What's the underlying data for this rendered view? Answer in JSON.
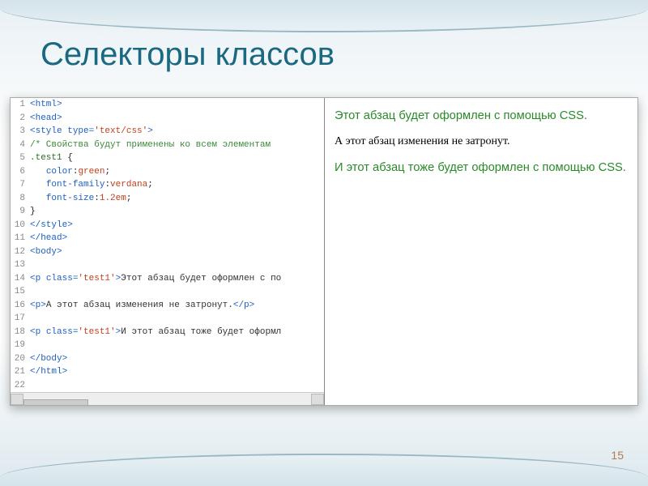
{
  "title": "Селекторы классов",
  "code": {
    "lines": [
      {
        "n": "1",
        "html": "<span class='tag'>&lt;html&gt;</span>"
      },
      {
        "n": "2",
        "html": "<span class='tag'>&lt;head&gt;</span>"
      },
      {
        "n": "3",
        "html": "<span class='tag'>&lt;style</span> <span class='attr'>type=</span><span class='val'>'text/css'</span><span class='tag'>&gt;</span>"
      },
      {
        "n": "4",
        "html": "<span class='comment'>/* Свойства будут применены ко всем элементам </span>"
      },
      {
        "n": "5",
        "html": "<span class='sel'>.test1</span> {"
      },
      {
        "n": "6",
        "html": "   <span class='prop'>color</span>:<span class='pval'>green</span>;"
      },
      {
        "n": "7",
        "html": "   <span class='prop'>font-family</span>:<span class='pval'>verdana</span>;"
      },
      {
        "n": "8",
        "html": "   <span class='prop'>font-size</span>:<span class='pval'>1.2em</span>;"
      },
      {
        "n": "9",
        "html": "}"
      },
      {
        "n": "10",
        "html": "<span class='tag'>&lt;/style&gt;</span>"
      },
      {
        "n": "11",
        "html": "<span class='tag'>&lt;/head&gt;</span>"
      },
      {
        "n": "12",
        "html": "<span class='tag'>&lt;body&gt;</span>"
      },
      {
        "n": "13",
        "html": ""
      },
      {
        "n": "14",
        "html": "<span class='tag'>&lt;p</span> <span class='attr'>class=</span><span class='val'>'test1'</span><span class='tag'>&gt;</span><span class='txt'>Этот абзац будет оформлен с по</span>"
      },
      {
        "n": "15",
        "html": ""
      },
      {
        "n": "16",
        "html": "<span class='tag'>&lt;p&gt;</span><span class='txt'>А этот абзац изменения не затронут.</span><span class='tag'>&lt;/p&gt;</span>"
      },
      {
        "n": "17",
        "html": ""
      },
      {
        "n": "18",
        "html": "<span class='tag'>&lt;p</span> <span class='attr'>class=</span><span class='val'>'test1'</span><span class='tag'>&gt;</span><span class='txt'>И этот абзац тоже будет оформл</span>"
      },
      {
        "n": "19",
        "html": ""
      },
      {
        "n": "20",
        "html": "<span class='tag'>&lt;/body&gt;</span>"
      },
      {
        "n": "21",
        "html": "<span class='tag'>&lt;/html&gt;</span>"
      },
      {
        "n": "22",
        "html": ""
      }
    ]
  },
  "preview": {
    "p1": "Этот абзац будет оформлен с помощью CSS.",
    "p2": "А этот абзац изменения не затронут.",
    "p3": "И этот абзац тоже будет оформлен с помощью CSS."
  },
  "page_number": "15"
}
